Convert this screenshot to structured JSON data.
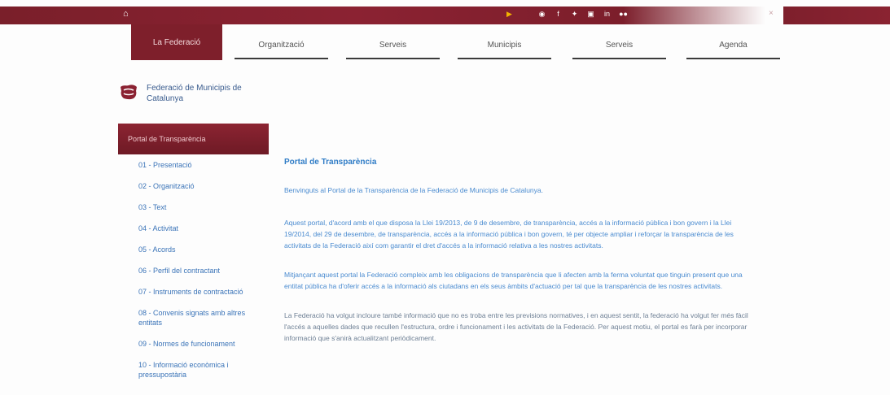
{
  "topbar": {
    "home_label": "⌂",
    "social_icons": [
      "google-play-icon",
      "apple-icon",
      "rss-icon",
      "facebook-icon",
      "twitter-icon",
      "youtube-icon",
      "linkedin-icon",
      "flickr-icon"
    ]
  },
  "nav": {
    "active": "La Federació",
    "items": [
      "Organització",
      "Serveis",
      "Municipis",
      "Serveis",
      "Agenda"
    ]
  },
  "brand": {
    "name": "Federació de Municipis de Catalunya"
  },
  "sidebar": {
    "header": "Portal de Transparència",
    "items": [
      "01 - Presentació",
      "02 - Organització",
      "03 - Text",
      "04 - Activitat",
      "05 - Acords",
      "06 - Perfil del contractant",
      "07 - Instruments de contractació",
      "08 - Convenis signats amb altres entitats",
      "09 - Normes de funcionament",
      "10 - Informació econòmica i pressupostària"
    ]
  },
  "main": {
    "title": "Portal de Transparència",
    "intro": "Benvinguts al Portal de la Transparència de la Federació de Municipis de Catalunya.",
    "p1": "Aquest portal, d'acord amb el que disposa la Llei 19/2013, de 9 de desembre, de transparència, accés a la informació pública i bon govern i la Llei 19/2014, del 29 de desembre, de transparència, accés a la informació pública i bon govern, té per objecte ampliar i reforçar la transparència de les activitats de la Federació així com garantir el dret d'accés a la informació relativa a les nostres activitats.",
    "p2": "Mitjançant aquest portal la Federació compleix amb les obligacions de transparència que li afecten amb la ferma voluntat que tinguin present que una entitat pública ha d'oferir accés a la informació als ciutadans en els seus àmbits d'actuació per tal que la transparència de les nostres activitats.",
    "p3": "La Federació ha volgut incloure també informació que no es troba entre les previsions normatives, i en aquest sentit, la federació ha volgut fer més fàcil l'accés a aquelles dades que recullen l'estructura, ordre i funcionament i les activitats de la Federació. Per aquest motiu, el portal es farà per incorporar informació que s'anirà actualitzant periòdicament."
  }
}
